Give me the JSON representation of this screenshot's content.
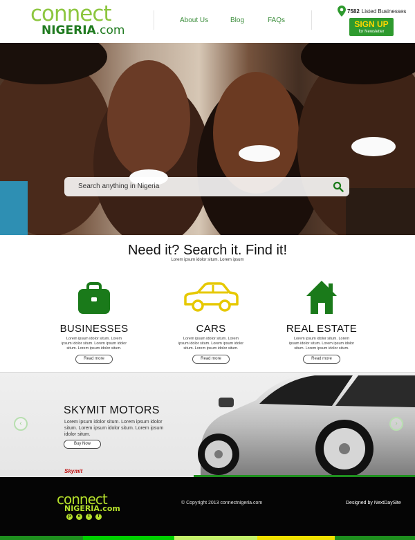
{
  "header": {
    "logo_top": "connect",
    "logo_bottom": "NIGERIA",
    "logo_domain": ".com",
    "nav": [
      "About Us",
      "Blog",
      "FAQs"
    ],
    "listed_count": "7582",
    "listed_label": "Listed Businesses",
    "signup_label": "SIGN UP",
    "signup_sub": "for Newsletter"
  },
  "hero": {
    "search_placeholder": "Search anything in Nigeria"
  },
  "intro": {
    "title": "Need it? Search it. Find it!",
    "subtitle": "Lorem ipsum idolor situm. Lorem ipsum"
  },
  "categories": [
    {
      "title": "BUSINESSES",
      "desc": "Lorem ipsum idolor situm. Lorem ipsum idolor situm. Lorem ipsum idolor situm. Lorem ipsum idolor situm.",
      "button": "Read more",
      "icon": "briefcase-icon"
    },
    {
      "title": "CARS",
      "desc": "Lorem ipsum idolor situm. Lorem ipsum idolor situm. Lorem ipsum idolor situm. Lorem ipsum idolor situm.",
      "button": "Read more",
      "icon": "car-icon"
    },
    {
      "title": "REAL ESTATE",
      "desc": "Lorem ipsum idolor situm. Lorem ipsum idolor situm. Lorem ipsum idolor situm. Lorem ipsum idolor situm.",
      "button": "Read more",
      "icon": "house-icon"
    }
  ],
  "banner": {
    "title": "SKYMIT MOTORS",
    "desc": "Lorem ipsum idolor situm. Lorem ipsum idolor situm. Lorem ipsum idolor situm. Lorem ipsum idolor situm.",
    "button": "Buy Now",
    "brand": "Skymit",
    "prev_icon": "chevron-left-icon",
    "next_icon": "chevron-right-icon"
  },
  "footer": {
    "logo_top": "connect",
    "logo_bottom": "NIGERIA.com",
    "copyright": "© Copyright 2013 connectnigeria.com",
    "credit": "Designed by NextDaySite",
    "social_icons": [
      "pinterest-icon",
      "globe-icon",
      "twitter-icon",
      "facebook-icon"
    ]
  },
  "colors": {
    "brand_green": "#2e9a2e",
    "light_green": "#8cc63f",
    "icon_green": "#1a7a1a",
    "car_yellow": "#e6c800",
    "signup_text": "#ffd700",
    "footer_bg": "#050505",
    "stripe": [
      "#1e8f1e",
      "#00d000",
      "#c4f06a",
      "#f0e000",
      "#1e8f1e"
    ]
  }
}
